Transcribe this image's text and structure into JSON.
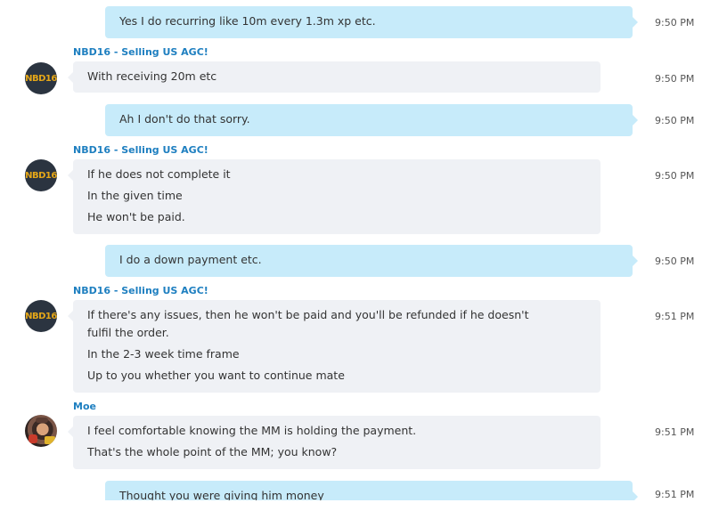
{
  "messages": [
    {
      "sender": "",
      "lines": [
        "Yes I do recurring like 10m every 1.3m xp etc."
      ],
      "time": "9:50 PM"
    },
    {
      "sender": "NBD16 - Selling US AGC!",
      "lines": [
        "With receiving 20m etc"
      ],
      "time": "9:50 PM"
    },
    {
      "sender": "",
      "lines": [
        "Ah I don't do that sorry."
      ],
      "time": "9:50 PM"
    },
    {
      "sender": "NBD16 - Selling US AGC!",
      "lines": [
        "If he does not complete it",
        "In the given time",
        "He won't be paid."
      ],
      "time": "9:50 PM"
    },
    {
      "sender": "",
      "lines": [
        "I do a down payment etc."
      ],
      "time": "9:50 PM"
    },
    {
      "sender": "NBD16 - Selling US AGC!",
      "lines": [
        "If there's any issues, then he won't be paid and you'll be refunded if he doesn't fulfil the order.",
        "In the 2-3 week time frame",
        "Up to you whether you want to continue mate"
      ],
      "time": "9:51 PM"
    },
    {
      "sender": "Moe",
      "lines": [
        "I feel comfortable knowing the MM is holding the payment.",
        "That's the whole point of the MM; you know?"
      ],
      "time": "9:51 PM"
    },
    {
      "sender": "",
      "lines": [
        "Thought you were giving him money"
      ],
      "time": "9:51 PM"
    }
  ],
  "avatars": {
    "nbd16": {
      "icon": "nbd16-avatar-icon",
      "text": "NBD16",
      "color": "#e5a718"
    },
    "moe": {
      "icon": "moe-avatar-photo"
    }
  },
  "colors": {
    "incoming_bubble": "#eff1f5",
    "outgoing_bubble": "#c7ebfa",
    "sender_name": "#1e7fc0",
    "text": "#333333",
    "timestamp": "#555555"
  }
}
